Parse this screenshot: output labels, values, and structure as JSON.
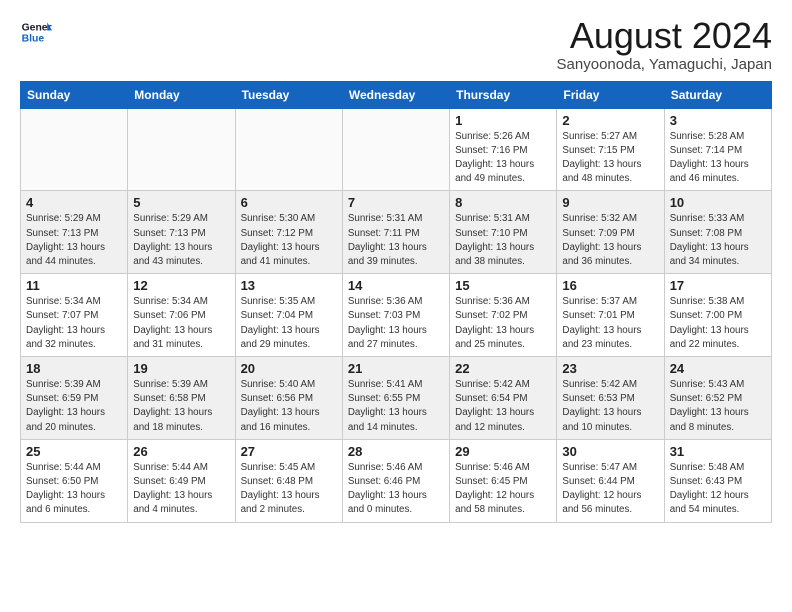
{
  "header": {
    "logo_line1": "General",
    "logo_line2": "Blue",
    "month_title": "August 2024",
    "location": "Sanyoonoda, Yamaguchi, Japan"
  },
  "weekdays": [
    "Sunday",
    "Monday",
    "Tuesday",
    "Wednesday",
    "Thursday",
    "Friday",
    "Saturday"
  ],
  "weeks": [
    [
      {
        "day": "",
        "info": ""
      },
      {
        "day": "",
        "info": ""
      },
      {
        "day": "",
        "info": ""
      },
      {
        "day": "",
        "info": ""
      },
      {
        "day": "1",
        "info": "Sunrise: 5:26 AM\nSunset: 7:16 PM\nDaylight: 13 hours\nand 49 minutes."
      },
      {
        "day": "2",
        "info": "Sunrise: 5:27 AM\nSunset: 7:15 PM\nDaylight: 13 hours\nand 48 minutes."
      },
      {
        "day": "3",
        "info": "Sunrise: 5:28 AM\nSunset: 7:14 PM\nDaylight: 13 hours\nand 46 minutes."
      }
    ],
    [
      {
        "day": "4",
        "info": "Sunrise: 5:29 AM\nSunset: 7:13 PM\nDaylight: 13 hours\nand 44 minutes."
      },
      {
        "day": "5",
        "info": "Sunrise: 5:29 AM\nSunset: 7:13 PM\nDaylight: 13 hours\nand 43 minutes."
      },
      {
        "day": "6",
        "info": "Sunrise: 5:30 AM\nSunset: 7:12 PM\nDaylight: 13 hours\nand 41 minutes."
      },
      {
        "day": "7",
        "info": "Sunrise: 5:31 AM\nSunset: 7:11 PM\nDaylight: 13 hours\nand 39 minutes."
      },
      {
        "day": "8",
        "info": "Sunrise: 5:31 AM\nSunset: 7:10 PM\nDaylight: 13 hours\nand 38 minutes."
      },
      {
        "day": "9",
        "info": "Sunrise: 5:32 AM\nSunset: 7:09 PM\nDaylight: 13 hours\nand 36 minutes."
      },
      {
        "day": "10",
        "info": "Sunrise: 5:33 AM\nSunset: 7:08 PM\nDaylight: 13 hours\nand 34 minutes."
      }
    ],
    [
      {
        "day": "11",
        "info": "Sunrise: 5:34 AM\nSunset: 7:07 PM\nDaylight: 13 hours\nand 32 minutes."
      },
      {
        "day": "12",
        "info": "Sunrise: 5:34 AM\nSunset: 7:06 PM\nDaylight: 13 hours\nand 31 minutes."
      },
      {
        "day": "13",
        "info": "Sunrise: 5:35 AM\nSunset: 7:04 PM\nDaylight: 13 hours\nand 29 minutes."
      },
      {
        "day": "14",
        "info": "Sunrise: 5:36 AM\nSunset: 7:03 PM\nDaylight: 13 hours\nand 27 minutes."
      },
      {
        "day": "15",
        "info": "Sunrise: 5:36 AM\nSunset: 7:02 PM\nDaylight: 13 hours\nand 25 minutes."
      },
      {
        "day": "16",
        "info": "Sunrise: 5:37 AM\nSunset: 7:01 PM\nDaylight: 13 hours\nand 23 minutes."
      },
      {
        "day": "17",
        "info": "Sunrise: 5:38 AM\nSunset: 7:00 PM\nDaylight: 13 hours\nand 22 minutes."
      }
    ],
    [
      {
        "day": "18",
        "info": "Sunrise: 5:39 AM\nSunset: 6:59 PM\nDaylight: 13 hours\nand 20 minutes."
      },
      {
        "day": "19",
        "info": "Sunrise: 5:39 AM\nSunset: 6:58 PM\nDaylight: 13 hours\nand 18 minutes."
      },
      {
        "day": "20",
        "info": "Sunrise: 5:40 AM\nSunset: 6:56 PM\nDaylight: 13 hours\nand 16 minutes."
      },
      {
        "day": "21",
        "info": "Sunrise: 5:41 AM\nSunset: 6:55 PM\nDaylight: 13 hours\nand 14 minutes."
      },
      {
        "day": "22",
        "info": "Sunrise: 5:42 AM\nSunset: 6:54 PM\nDaylight: 13 hours\nand 12 minutes."
      },
      {
        "day": "23",
        "info": "Sunrise: 5:42 AM\nSunset: 6:53 PM\nDaylight: 13 hours\nand 10 minutes."
      },
      {
        "day": "24",
        "info": "Sunrise: 5:43 AM\nSunset: 6:52 PM\nDaylight: 13 hours\nand 8 minutes."
      }
    ],
    [
      {
        "day": "25",
        "info": "Sunrise: 5:44 AM\nSunset: 6:50 PM\nDaylight: 13 hours\nand 6 minutes."
      },
      {
        "day": "26",
        "info": "Sunrise: 5:44 AM\nSunset: 6:49 PM\nDaylight: 13 hours\nand 4 minutes."
      },
      {
        "day": "27",
        "info": "Sunrise: 5:45 AM\nSunset: 6:48 PM\nDaylight: 13 hours\nand 2 minutes."
      },
      {
        "day": "28",
        "info": "Sunrise: 5:46 AM\nSunset: 6:46 PM\nDaylight: 13 hours\nand 0 minutes."
      },
      {
        "day": "29",
        "info": "Sunrise: 5:46 AM\nSunset: 6:45 PM\nDaylight: 12 hours\nand 58 minutes."
      },
      {
        "day": "30",
        "info": "Sunrise: 5:47 AM\nSunset: 6:44 PM\nDaylight: 12 hours\nand 56 minutes."
      },
      {
        "day": "31",
        "info": "Sunrise: 5:48 AM\nSunset: 6:43 PM\nDaylight: 12 hours\nand 54 minutes."
      }
    ]
  ]
}
